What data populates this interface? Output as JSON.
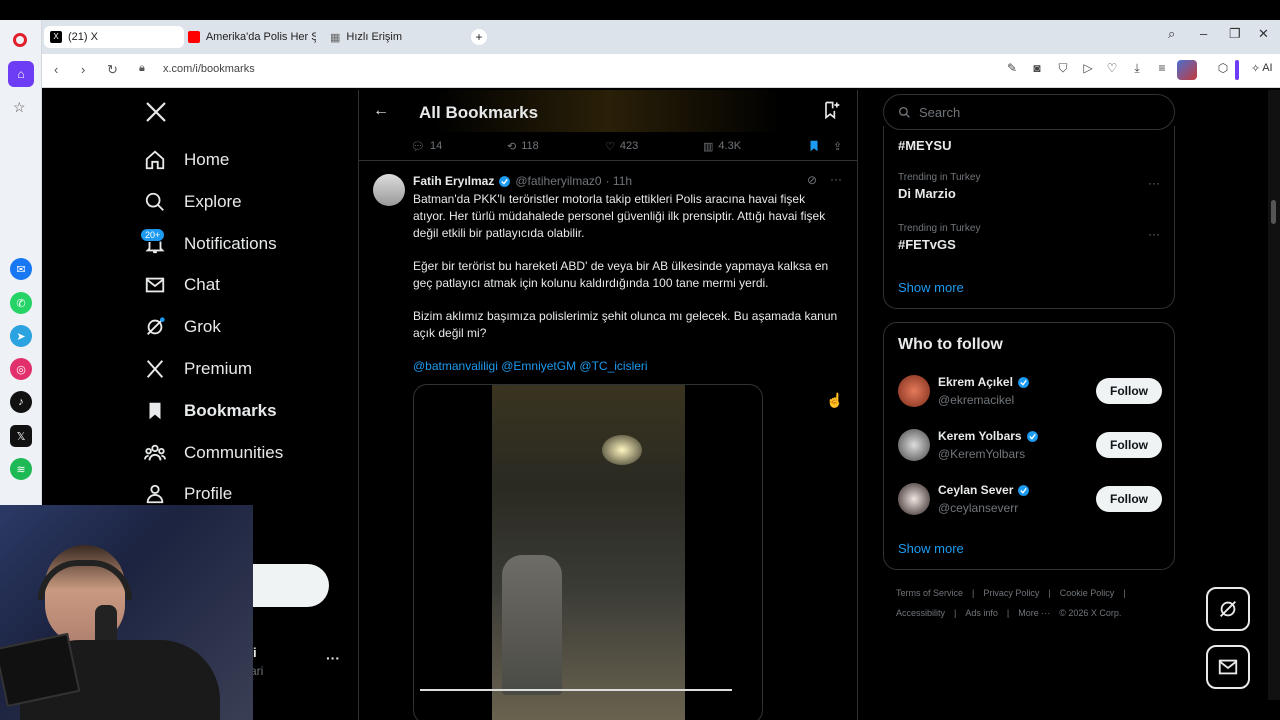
{
  "browser": {
    "tabs": [
      {
        "label": "(21) X",
        "active": true
      },
      {
        "label": "Amerika'da Polis Her Şeyi",
        "active": false
      },
      {
        "label": "Hızlı Erişim",
        "active": false
      }
    ],
    "url": "x.com/i/bookmarks",
    "ai_label": "AI"
  },
  "nav": {
    "items": [
      {
        "label": "Home",
        "icon": "home-icon"
      },
      {
        "label": "Explore",
        "icon": "search-icon"
      },
      {
        "label": "Notifications",
        "icon": "bell-icon"
      },
      {
        "label": "Chat",
        "icon": "mail-icon"
      },
      {
        "label": "Grok",
        "icon": "grok-icon"
      },
      {
        "label": "Premium",
        "icon": "x-logo-icon"
      },
      {
        "label": "Bookmarks",
        "icon": "bookmark-icon"
      },
      {
        "label": "Communities",
        "icon": "people-icon"
      },
      {
        "label": "Profile",
        "icon": "person-icon"
      }
    ],
    "notif_badge": "20+",
    "more_dots": "···",
    "profile_name_frag": "i",
    "profile_handle_frag": "ari"
  },
  "main": {
    "title": "All Bookmarks",
    "prev_actions": {
      "replies": "14",
      "reposts": "118",
      "likes": "423",
      "views": "4.3K"
    },
    "tweet": {
      "name": "Fatih Eryılmaz",
      "handle": "@fatiheryilmaz0",
      "time": "· 11h",
      "p1": "Batman'da PKK'lı teröristler motorla takip ettikleri Polis aracına havai fişek atıyor. Her türlü müdahalede personel güvenliği ilk prensiptir. Attığı havai fişek değil etkili bir patlayıcıda olabilir.",
      "p2": "Eğer bir terörist bu hareketi ABD' de veya bir AB ülkesinde yapmaya kalksa en geç patlayıcı atmak için kolunu kaldırdığında 100 tane mermi yerdi.",
      "p3": "Bizim aklımız başımıza polislerimiz şehit olunca mı gelecek. Bu aşamada kanun açık değil mi?",
      "mentions": "@batmanvaliligi @EmniyetGM @TC_icisleri"
    }
  },
  "right": {
    "search_placeholder": "Search",
    "trends": [
      {
        "category": "",
        "name": "#MEYSU"
      },
      {
        "category": "Trending in Turkey",
        "name": "Di Marzio"
      },
      {
        "category": "Trending in Turkey",
        "name": "#FETvGS"
      }
    ],
    "trends_show_more": "Show more",
    "wtf_title": "Who to follow",
    "wtf": [
      {
        "name": "Ekrem Açıkel",
        "handle": "@ekremacikel",
        "button": "Follow"
      },
      {
        "name": "Kerem Yolbars",
        "handle": "@KeremYolbars",
        "button": "Follow"
      },
      {
        "name": "Ceylan Sever",
        "handle": "@ceylanseverr",
        "button": "Follow"
      }
    ],
    "wtf_show_more": "Show more",
    "footer_row1": [
      "Terms of Service",
      "|",
      "Privacy Policy",
      "|",
      "Cookie Policy",
      "|"
    ],
    "footer_row2": [
      "Accessibility",
      "|",
      "Ads info",
      "|",
      "More ···",
      "© 2026 X Corp."
    ]
  },
  "colors": {
    "accent": "#1d9bf0",
    "bg": "#000000",
    "text": "#e7e9ea",
    "muted": "#71767b",
    "border": "#2f3336"
  }
}
